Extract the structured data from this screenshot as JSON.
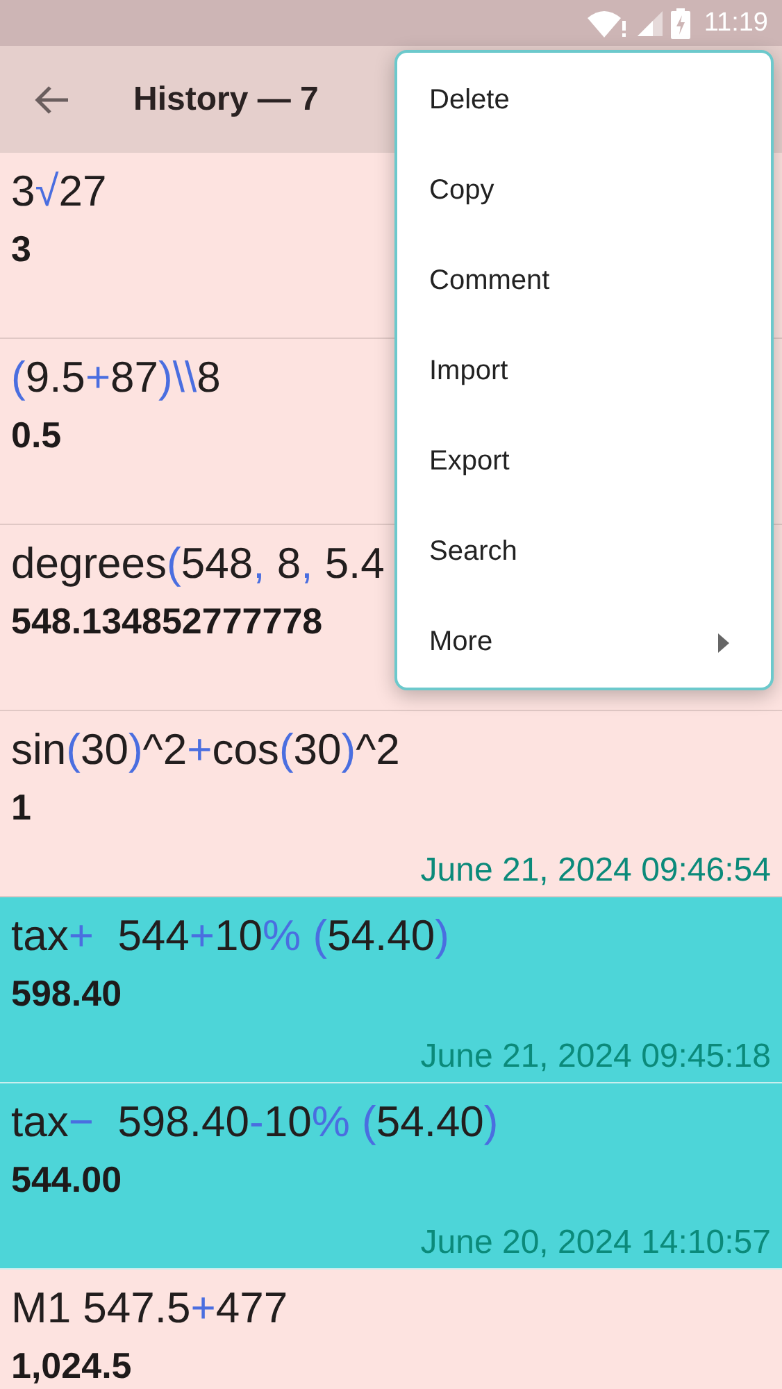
{
  "status_bar": {
    "time": "11:19"
  },
  "toolbar": {
    "title": "History — 7"
  },
  "rows": [
    {
      "expression": [
        {
          "text": "3",
          "kind": "operand"
        },
        {
          "text": "√",
          "kind": "operator"
        },
        {
          "text": "27",
          "kind": "operand"
        }
      ],
      "result": "3",
      "selected": false
    },
    {
      "expression": [
        {
          "text": "(",
          "kind": "operator"
        },
        {
          "text": "9.5",
          "kind": "operand"
        },
        {
          "text": "+",
          "kind": "operator"
        },
        {
          "text": "87",
          "kind": "operand"
        },
        {
          "text": ")\\\\",
          "kind": "operator"
        },
        {
          "text": "8",
          "kind": "operand"
        }
      ],
      "result": "0.5",
      "selected": false
    },
    {
      "expression": [
        {
          "text": "degrees",
          "kind": "operand"
        },
        {
          "text": "(",
          "kind": "operator"
        },
        {
          "text": "548",
          "kind": "operand"
        },
        {
          "text": ",",
          "kind": "operator"
        },
        {
          "text": " 8",
          "kind": "operand"
        },
        {
          "text": ",",
          "kind": "operator"
        },
        {
          "text": " 5.4",
          "kind": "operand"
        }
      ],
      "result": "548.134852777778",
      "selected": false
    },
    {
      "expression": [
        {
          "text": "sin",
          "kind": "operand"
        },
        {
          "text": "(",
          "kind": "operator"
        },
        {
          "text": "30",
          "kind": "operand"
        },
        {
          "text": ")",
          "kind": "operator"
        },
        {
          "text": "^2",
          "kind": "operand"
        },
        {
          "text": "+",
          "kind": "operator"
        },
        {
          "text": "cos",
          "kind": "operand"
        },
        {
          "text": "(",
          "kind": "operator"
        },
        {
          "text": "30",
          "kind": "operand"
        },
        {
          "text": ")",
          "kind": "operator"
        },
        {
          "text": "^2",
          "kind": "operand"
        }
      ],
      "result": "1",
      "timestamp": "June 21, 2024 09:46:54",
      "selected": false
    },
    {
      "expression": [
        {
          "text": "tax",
          "kind": "operand"
        },
        {
          "text": "+",
          "kind": "operator"
        },
        {
          "text": "  544",
          "kind": "operand"
        },
        {
          "text": "+",
          "kind": "operator"
        },
        {
          "text": "10",
          "kind": "operand"
        },
        {
          "text": "%",
          "kind": "operator"
        },
        {
          "text": " (",
          "kind": "operator"
        },
        {
          "text": "54.40",
          "kind": "operand"
        },
        {
          "text": ")",
          "kind": "operator"
        }
      ],
      "result": "598.40",
      "timestamp": "June 21, 2024 09:45:18",
      "selected": true
    },
    {
      "expression": [
        {
          "text": "tax",
          "kind": "operand"
        },
        {
          "text": "−",
          "kind": "operator"
        },
        {
          "text": "  598.40",
          "kind": "operand"
        },
        {
          "text": "-",
          "kind": "operator"
        },
        {
          "text": "10",
          "kind": "operand"
        },
        {
          "text": "%",
          "kind": "operator"
        },
        {
          "text": " (",
          "kind": "operator"
        },
        {
          "text": "54.40",
          "kind": "operand"
        },
        {
          "text": ")",
          "kind": "operator"
        }
      ],
      "result": "544.00",
      "timestamp": "June 20, 2024 14:10:57",
      "selected": true
    },
    {
      "expression": [
        {
          "text": "M1 547.5",
          "kind": "operand"
        },
        {
          "text": "+",
          "kind": "operator"
        },
        {
          "text": "477",
          "kind": "operand"
        }
      ],
      "result": "1,024.5",
      "selected": false
    }
  ],
  "menu": {
    "items": [
      {
        "label": "Delete",
        "submenu": false
      },
      {
        "label": "Copy",
        "submenu": false
      },
      {
        "label": "Comment",
        "submenu": false
      },
      {
        "label": "Import",
        "submenu": false
      },
      {
        "label": "Export",
        "submenu": false
      },
      {
        "label": "Search",
        "submenu": false
      },
      {
        "label": "More",
        "submenu": true
      }
    ]
  }
}
